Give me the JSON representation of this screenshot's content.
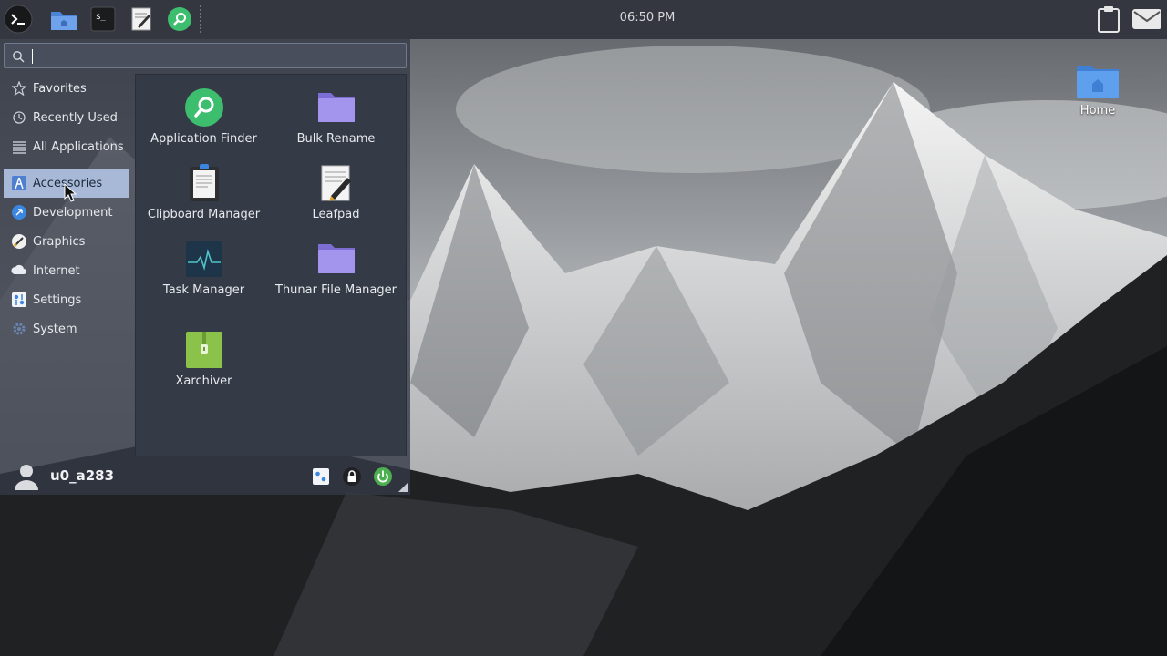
{
  "panel": {
    "clock": "06:50 PM",
    "launchers": [
      "terminal-menu-icon",
      "file-manager-icon",
      "terminal-icon",
      "text-editor-icon",
      "app-finder-icon"
    ]
  },
  "menu": {
    "search": {
      "value": "",
      "placeholder": ""
    },
    "categories": [
      {
        "label": "Favorites",
        "icon": "star-icon"
      },
      {
        "label": "Recently Used",
        "icon": "history-icon"
      },
      {
        "label": "All Applications",
        "icon": "list-icon"
      },
      {
        "label": "Accessories",
        "icon": "accessories-icon",
        "selected": true
      },
      {
        "label": "Development",
        "icon": "development-icon"
      },
      {
        "label": "Graphics",
        "icon": "graphics-icon"
      },
      {
        "label": "Internet",
        "icon": "internet-icon"
      },
      {
        "label": "Settings",
        "icon": "settings-icon"
      },
      {
        "label": "System",
        "icon": "system-icon"
      }
    ],
    "apps": [
      {
        "label": "Application Finder",
        "icon": "app-finder-icon"
      },
      {
        "label": "Bulk Rename",
        "icon": "folder-icon"
      },
      {
        "label": "Clipboard Manager",
        "icon": "clipboard-icon"
      },
      {
        "label": "Leafpad",
        "icon": "text-editor-icon"
      },
      {
        "label": "Task Manager",
        "icon": "task-manager-icon"
      },
      {
        "label": "Thunar File Manager",
        "icon": "folder-icon"
      },
      {
        "label": "Xarchiver",
        "icon": "archive-icon"
      }
    ],
    "user": {
      "name": "u0_a283"
    },
    "colors": {
      "accent": "#a7b9d6",
      "folder": "#9b8ee6",
      "finder_green": "#3dbd6e",
      "archiver_green": "#8bc34a"
    }
  },
  "desktop": {
    "icons": [
      {
        "label": "Home",
        "icon": "home-folder-icon"
      }
    ]
  }
}
